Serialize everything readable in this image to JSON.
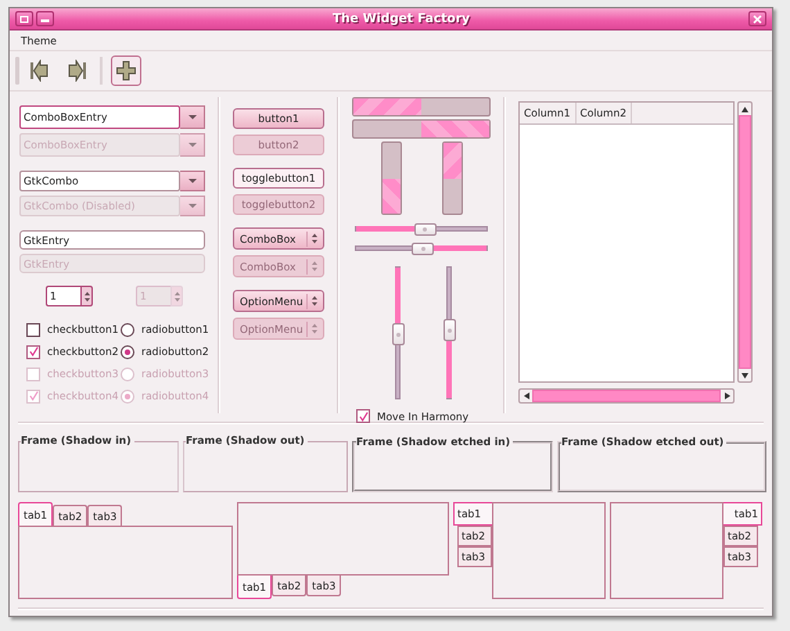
{
  "window": {
    "title": "The Widget Factory"
  },
  "menu": [
    {
      "label": "Theme"
    }
  ],
  "toolbar": [
    {
      "kind": "first",
      "active": false
    },
    {
      "kind": "last",
      "active": false
    },
    {
      "kind": "add",
      "active": true
    }
  ],
  "entries": [
    {
      "kind": "combo_entry",
      "value": "ComboBoxEntry",
      "disabled": false
    },
    {
      "kind": "combo_entry",
      "value": "ComboBoxEntry",
      "disabled": true
    },
    {
      "kind": "combo",
      "value": "GtkCombo",
      "disabled": false
    },
    {
      "kind": "combo",
      "value": "GtkCombo (Disabled)",
      "disabled": true
    },
    {
      "kind": "entry",
      "value": "GtkEntry",
      "disabled": false
    },
    {
      "kind": "entry",
      "value": "GtkEntry",
      "disabled": true
    }
  ],
  "spin_buttons": [
    {
      "value": "1",
      "disabled": false
    },
    {
      "value": "1",
      "disabled": true
    }
  ],
  "checks": [
    {
      "label": "checkbutton1",
      "checked": false,
      "disabled": false
    },
    {
      "label": "checkbutton2",
      "checked": true,
      "disabled": false
    },
    {
      "label": "checkbutton3",
      "checked": false,
      "disabled": true
    },
    {
      "label": "checkbutton4",
      "checked": true,
      "disabled": true
    }
  ],
  "radios": [
    {
      "label": "radiobutton1",
      "selected": false,
      "disabled": false
    },
    {
      "label": "radiobutton2",
      "selected": true,
      "disabled": false
    },
    {
      "label": "radiobutton3",
      "selected": false,
      "disabled": true
    },
    {
      "label": "radiobutton4",
      "selected": true,
      "disabled": true
    }
  ],
  "buttons": [
    {
      "kind": "button",
      "label": "button1",
      "disabled": false
    },
    {
      "kind": "button",
      "label": "button2",
      "disabled": true
    },
    {
      "kind": "toggle",
      "label": "togglebutton1",
      "disabled": false
    },
    {
      "kind": "toggle",
      "label": "togglebutton2",
      "disabled": true
    },
    {
      "kind": "combo",
      "label": "ComboBox",
      "disabled": false
    },
    {
      "kind": "combo",
      "label": "ComboBox",
      "disabled": true
    },
    {
      "kind": "option",
      "label": "OptionMenu",
      "disabled": false
    },
    {
      "kind": "option",
      "label": "OptionMenu",
      "disabled": true
    }
  ],
  "progress_bars": [
    {
      "kind": "horizontal",
      "inverted": false,
      "level": 0.5
    },
    {
      "kind": "horizontal",
      "inverted": true,
      "level": 0.5
    },
    {
      "kind": "vertical",
      "inverted": true,
      "level": 0.5
    },
    {
      "kind": "vertical",
      "inverted": false,
      "level": 0.5
    }
  ],
  "scales": [
    {
      "kind": "horizontal",
      "inverted": false,
      "level": 0.52
    },
    {
      "kind": "horizontal",
      "inverted": true,
      "level": 0.5
    },
    {
      "kind": "vertical",
      "inverted": false,
      "level": 0.5
    },
    {
      "kind": "vertical",
      "inverted": true,
      "level": 0.47
    }
  ],
  "harmony_check": {
    "label": "Move In Harmony",
    "checked": true
  },
  "tree": {
    "columns": [
      "Column1",
      "Column2"
    ]
  },
  "frames": [
    {
      "label": "Frame (Shadow in)",
      "kind": "in"
    },
    {
      "label": "Frame (Shadow out)",
      "kind": "out"
    },
    {
      "label": "Frame (Shadow etched in)",
      "kind": "etched_in"
    },
    {
      "label": "Frame (Shadow etched out)",
      "kind": "etched_out"
    }
  ],
  "notebooks": [
    {
      "kind": "top",
      "tabs": [
        {
          "label": "tab1",
          "selected": true
        },
        {
          "label": "tab2",
          "selected": false
        },
        {
          "label": "tab3",
          "selected": false
        }
      ]
    },
    {
      "kind": "bottom",
      "tabs": [
        {
          "label": "tab1",
          "selected": true
        },
        {
          "label": "tab2",
          "selected": false
        },
        {
          "label": "tab3",
          "selected": false
        }
      ]
    },
    {
      "kind": "left",
      "tabs": [
        {
          "label": "tab1",
          "selected": true
        },
        {
          "label": "tab2",
          "selected": false
        },
        {
          "label": "tab3",
          "selected": false
        }
      ]
    },
    {
      "kind": "right",
      "tabs": [
        {
          "label": "tab1",
          "selected": true
        },
        {
          "label": "tab2",
          "selected": false
        },
        {
          "label": "tab3",
          "selected": false
        }
      ]
    }
  ]
}
